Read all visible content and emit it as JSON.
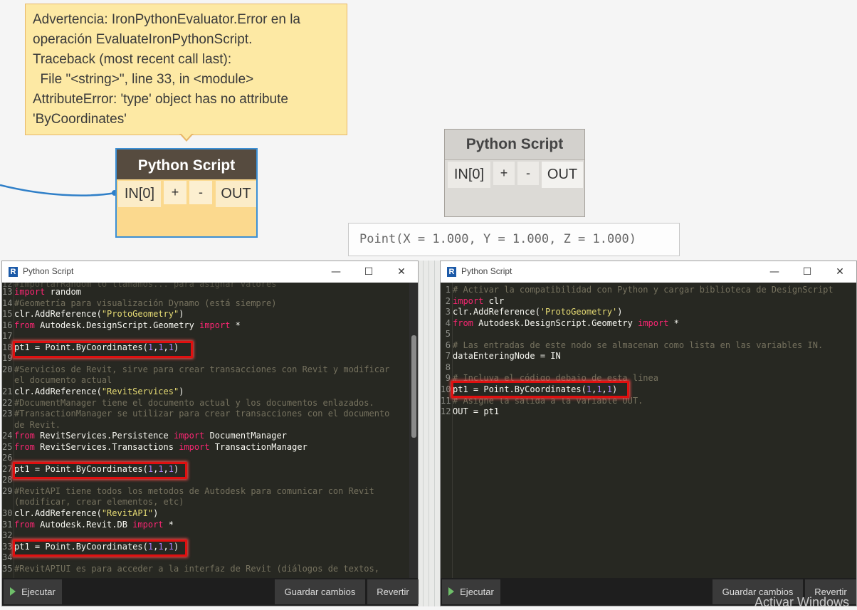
{
  "warning": {
    "lines": [
      "Advertencia: IronPythonEvaluator.Error en la",
      "operación EvaluateIronPythonScript.",
      "Traceback (most recent call last):",
      "  File \"<string>\", line 33, in <module>",
      "AttributeError: 'type' object has no attribute",
      "'ByCoordinates'"
    ]
  },
  "node1": {
    "title": "Python Script",
    "in_port": "IN[0]",
    "plus": "+",
    "minus": "-",
    "out_port": "OUT"
  },
  "node2": {
    "title": "Python Script",
    "in_port": "IN[0]",
    "plus": "+",
    "minus": "-",
    "out_port": "OUT"
  },
  "preview": {
    "value": "Point(X = 1.000, Y = 1.000, Z = 1.000)"
  },
  "editor_left": {
    "title": "Python Script",
    "buttons": {
      "run": "Ejecutar",
      "save": "Guardar cambios",
      "revert": "Revertir"
    },
    "lines": [
      {
        "n": "13",
        "t": "import random"
      },
      {
        "n": "14",
        "t": "#Geometría para visualización Dynamo (está siempre)"
      },
      {
        "n": "15",
        "t": "clr.AddReference(\"ProtoGeometry\")"
      },
      {
        "n": "16",
        "t": "from Autodesk.DesignScript.Geometry import *"
      },
      {
        "n": "17",
        "t": ""
      },
      {
        "n": "18",
        "t": "pt1 = Point.ByCoordinates(1,1,1)"
      },
      {
        "n": "19",
        "t": ""
      },
      {
        "n": "20",
        "t": "#Servicios de Revit, sirve para crear transacciones con Revit y modificar"
      },
      {
        "n": "",
        "t": "el documento actual"
      },
      {
        "n": "21",
        "t": "clr.AddReference(\"RevitServices\")"
      },
      {
        "n": "22",
        "t": "#DocumentManager tiene el documento actual y los documentos enlazados."
      },
      {
        "n": "23",
        "t": "#TransactionManager se utilizar para crear transacciones con el documento"
      },
      {
        "n": "",
        "t": "de Revit."
      },
      {
        "n": "24",
        "t": "from RevitServices.Persistence import DocumentManager"
      },
      {
        "n": "25",
        "t": "from RevitServices.Transactions import TransactionManager"
      },
      {
        "n": "26",
        "t": ""
      },
      {
        "n": "27",
        "t": "pt1 = Point.ByCoordinates(1,1,1)"
      },
      {
        "n": "28",
        "t": ""
      },
      {
        "n": "29",
        "t": "#RevitAPI tiene todos los metodos de Autodesk para comunicar con Revit"
      },
      {
        "n": "",
        "t": "(modificar, crear elementos, etc)"
      },
      {
        "n": "30",
        "t": "clr.AddReference(\"RevitAPI\")"
      },
      {
        "n": "31",
        "t": "from Autodesk.Revit.DB import *"
      },
      {
        "n": "32",
        "t": ""
      },
      {
        "n": "33",
        "t": "pt1 = Point.ByCoordinates(1,1,1)"
      },
      {
        "n": "34",
        "t": ""
      },
      {
        "n": "35",
        "t": "#RevitAPIUI es para acceder a la interfaz de Revit (diálogos de textos,"
      }
    ]
  },
  "editor_right": {
    "title": "Python Script",
    "buttons": {
      "run": "Ejecutar",
      "save": "Guardar cambios",
      "revert": "Revertir"
    },
    "lines": [
      {
        "n": "1",
        "t": "# Activar la compatibilidad con Python y cargar biblioteca de DesignScript"
      },
      {
        "n": "2",
        "t": "import clr"
      },
      {
        "n": "3",
        "t": "clr.AddReference('ProtoGeometry')"
      },
      {
        "n": "4",
        "t": "from Autodesk.DesignScript.Geometry import *"
      },
      {
        "n": "5",
        "t": ""
      },
      {
        "n": "6",
        "t": "# Las entradas de este nodo se almacenan como lista en las variables IN."
      },
      {
        "n": "7",
        "t": "dataEnteringNode = IN"
      },
      {
        "n": "8",
        "t": ""
      },
      {
        "n": "9",
        "t": "# Incluya el código debajo de esta línea"
      },
      {
        "n": "10",
        "t": "pt1 = Point.ByCoordinates(1,1,1)"
      },
      {
        "n": "11",
        "t": "# Asigne la salida a la variable OUT."
      },
      {
        "n": "12",
        "t": "OUT = pt1"
      }
    ]
  },
  "watermark": "Activar Windows",
  "colors": {
    "highlight": "#e01010",
    "editor_bg": "#272822",
    "node_header": "#564b3f",
    "warning_bg": "#fde9a4",
    "selection": "#3c8fd4"
  }
}
